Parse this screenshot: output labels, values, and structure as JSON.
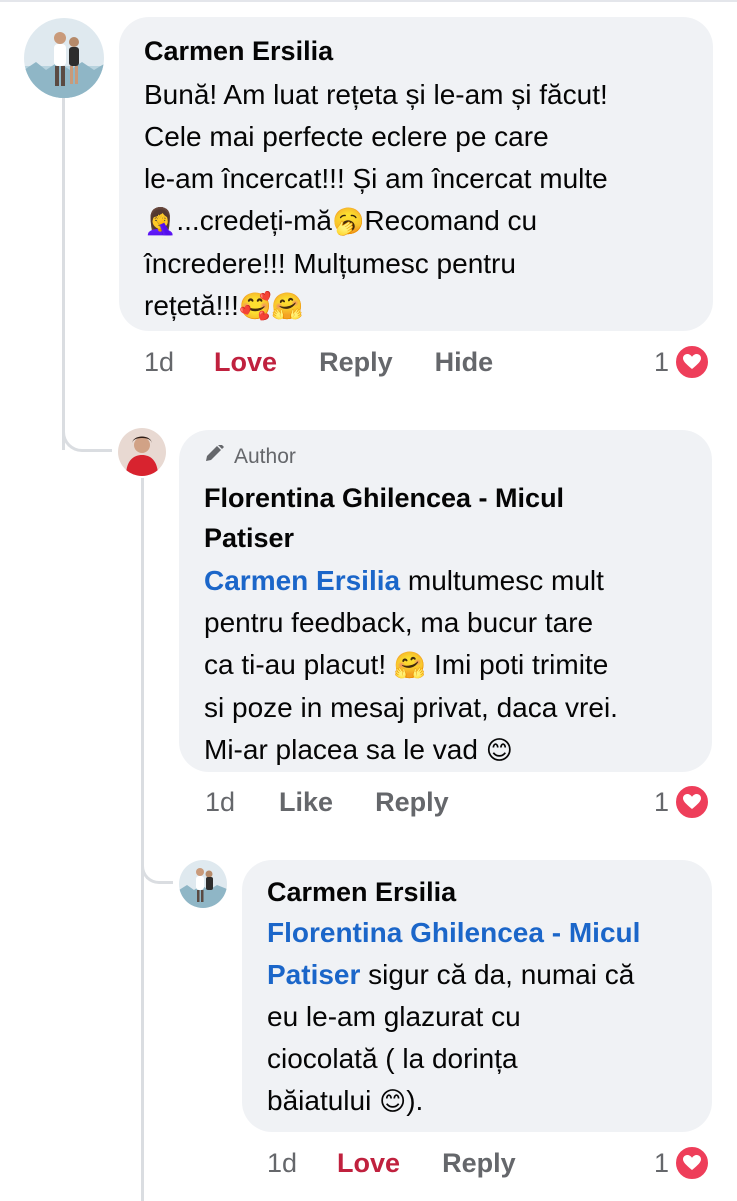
{
  "comments": [
    {
      "author": "Carmen Ersilia",
      "text_lines": [
        "Bună! Am luat rețeta și le-am și făcut!",
        "Cele mai perfecte eclere pe care",
        "le-am încercat!!! Și am încercat multe",
        "...credeți-mă",
        "Recomand cu",
        "încredere!!! Mulțumesc pentru",
        "rețetă!!!"
      ],
      "emojis": {
        "facepalm": "🤦‍♀️",
        "yawn": "🥱",
        "love_face": "🥰",
        "hug": "🤗"
      },
      "time": "1d",
      "actions": [
        "Love",
        "Reply",
        "Hide"
      ],
      "reaction_count": "1"
    },
    {
      "badge": "Author",
      "author_line1": "Florentina Ghilencea - Micul",
      "author_line2": "Patiser",
      "mention": "Carmen Ersilia",
      "text_lines": [
        " multumesc mult",
        "pentru feedback, ma bucur tare",
        "ca ti-au placut! ",
        " Imi poti trimite",
        "si poze in mesaj privat, daca vrei.",
        "Mi-ar placea sa le vad "
      ],
      "emojis": {
        "hug": "🤗",
        "smile": "😊"
      },
      "time": "1d",
      "actions": [
        "Like",
        "Reply"
      ],
      "reaction_count": "1"
    },
    {
      "author": "Carmen Ersilia",
      "mention_line1": "Florentina Ghilencea - Micul",
      "mention_line2": "Patiser",
      "text_lines": [
        " sigur că da, numai că",
        "eu le-am glazurat cu",
        "ciocolată ( la dorința",
        "băiatului ",
        ")."
      ],
      "emojis": {
        "smile": "😊"
      },
      "time": "1d",
      "actions": [
        "Love",
        "Reply"
      ],
      "reaction_count": "1"
    }
  ],
  "colors": {
    "bubble": "#f0f2f5",
    "mention": "#1b66c9",
    "love": "#c0213e",
    "heart": "#ee3e5a",
    "meta": "#65676b"
  },
  "icons": [
    "pencil-icon",
    "heart-icon"
  ]
}
